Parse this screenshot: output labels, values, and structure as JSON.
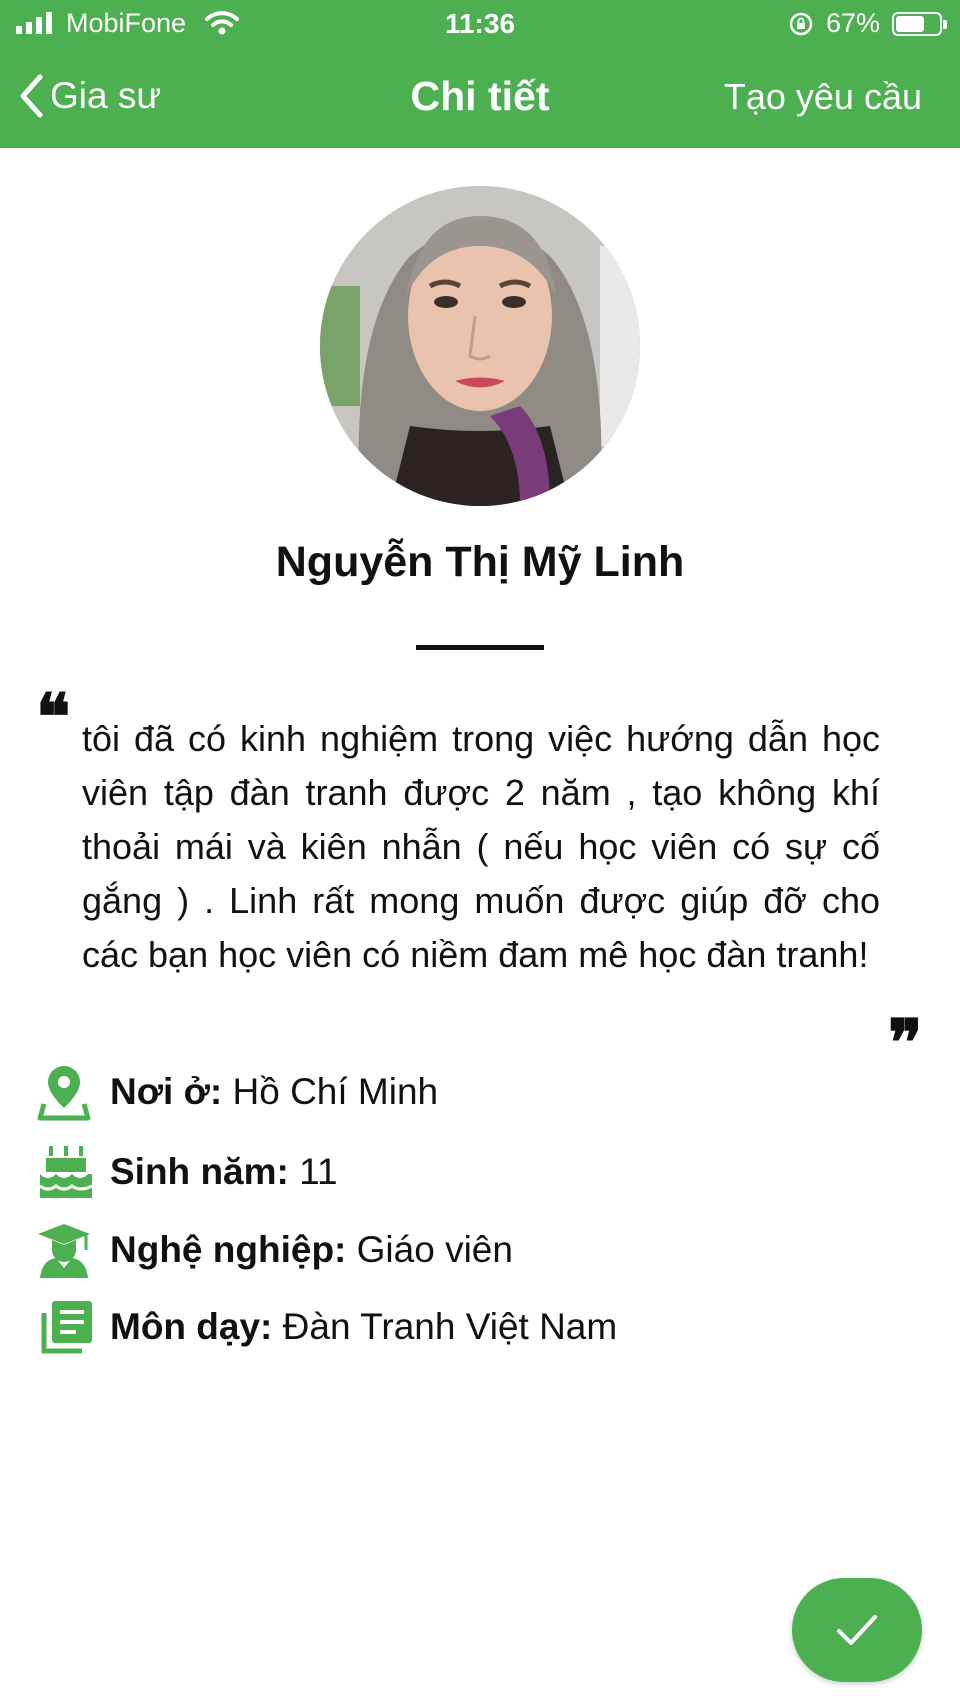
{
  "status_bar": {
    "carrier": "MobiFone",
    "time": "11:36",
    "battery_percent_text": "67%",
    "battery_level": 0.67,
    "icons": [
      "signal-icon",
      "wifi-icon",
      "orientation-lock-icon",
      "battery-icon"
    ]
  },
  "nav": {
    "back_label": "Gia sư",
    "title": "Chi tiết",
    "action_label": "Tạo yêu cầu"
  },
  "profile": {
    "name": "Nguyễn Thị Mỹ Linh",
    "bio": "tôi đã có kinh nghiệm trong việc hướng dẫn học viên tập đàn tranh được 2 năm , tạo không khí thoải mái và kiên nhẫn ( nếu học viên có sự cố gắng )  . Linh rất mong muốn được giúp đỡ cho các bạn học viên có niềm đam mê học đàn tranh!",
    "quote_open": "❝",
    "quote_close": "❞"
  },
  "info": [
    {
      "icon": "location-pin-icon",
      "label": "Nơi ở:",
      "value": " Hồ Chí Minh"
    },
    {
      "icon": "birthday-cake-icon",
      "label": "Sinh năm:",
      "value": " 11"
    },
    {
      "icon": "graduate-icon",
      "label": "Nghệ nghiệp:",
      "value": " Giáo viên"
    },
    {
      "icon": "book-list-icon",
      "label": "Môn dạy:",
      "value": " Đàn Tranh Việt Nam"
    }
  ],
  "fab": {
    "icon": "checkmark-icon"
  },
  "colors": {
    "primary": "#4caf50",
    "text": "#111111",
    "background": "#ffffff"
  }
}
